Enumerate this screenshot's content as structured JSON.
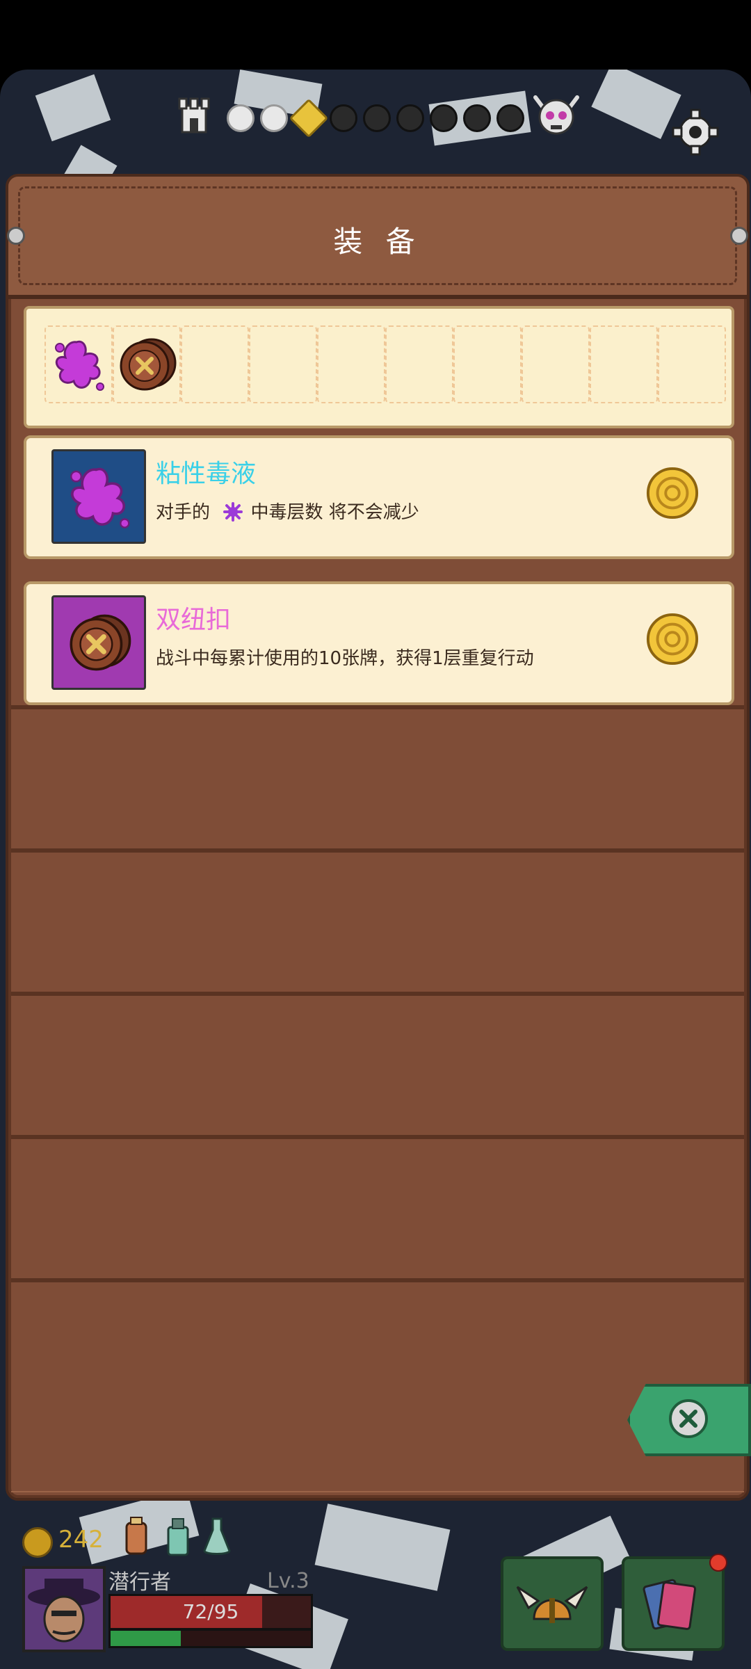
{
  "panel": {
    "title": "装 备"
  },
  "slots": {
    "filled": [
      "slime-icon",
      "button-icon"
    ],
    "total": 10
  },
  "items": [
    {
      "name": "粘性毒液",
      "name_color": "#3ad0e8",
      "icon": "slime-icon",
      "icon_bg": "#1f4d86",
      "desc_before": "对手的",
      "desc_after": "中毒层数 将不会减少",
      "inline_icon": "poison-icon"
    },
    {
      "name": "双纽扣",
      "name_color": "#e86ad8",
      "icon": "button-icon",
      "icon_bg": "#a03ab0",
      "desc": "战斗中每累计使用的10张牌，获得1层重复行动"
    }
  ],
  "hud": {
    "gold": "242",
    "hero_name": "潜行者",
    "level": "Lv.3",
    "hp_text": "72/95",
    "hp_fraction": 0.758,
    "xp_fraction": 0.35
  },
  "map": {
    "completed_nodes": 2,
    "current_node": 3,
    "total_nodes": 9
  },
  "colors": {
    "panel_wood": "#7f4d37",
    "parchment": "#fcf0d2",
    "close_green": "#3aa36e"
  }
}
